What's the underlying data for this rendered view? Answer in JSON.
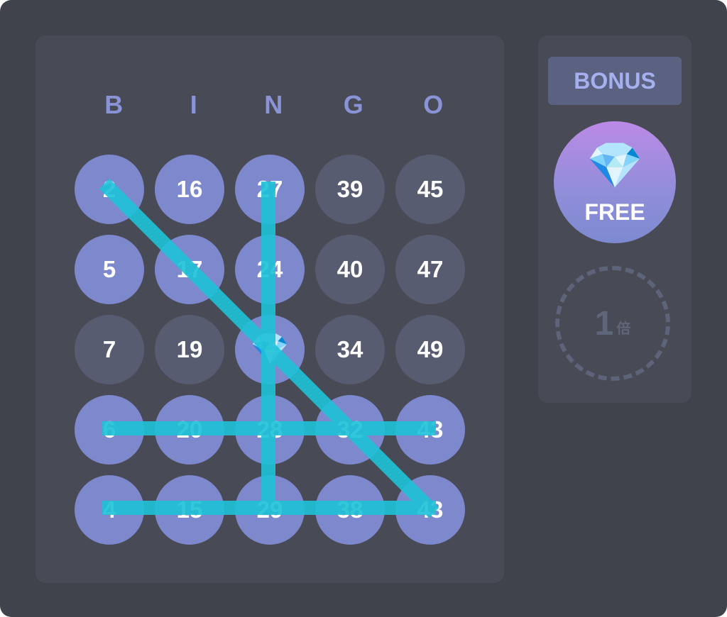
{
  "header": [
    "B",
    "I",
    "N",
    "G",
    "O"
  ],
  "grid": [
    [
      {
        "label": "2",
        "marked": true
      },
      {
        "label": "16",
        "marked": true
      },
      {
        "label": "27",
        "marked": true
      },
      {
        "label": "39",
        "marked": false
      },
      {
        "label": "45",
        "marked": false
      }
    ],
    [
      {
        "label": "5",
        "marked": true
      },
      {
        "label": "17",
        "marked": true
      },
      {
        "label": "24",
        "marked": true
      },
      {
        "label": "40",
        "marked": false
      },
      {
        "label": "47",
        "marked": false
      }
    ],
    [
      {
        "label": "7",
        "marked": false
      },
      {
        "label": "19",
        "marked": false
      },
      {
        "label": "💎",
        "marked": true,
        "free": true
      },
      {
        "label": "34",
        "marked": false
      },
      {
        "label": "49",
        "marked": false
      }
    ],
    [
      {
        "label": "6",
        "marked": true
      },
      {
        "label": "20",
        "marked": true
      },
      {
        "label": "28",
        "marked": true
      },
      {
        "label": "32",
        "marked": true
      },
      {
        "label": "43",
        "marked": true
      }
    ],
    [
      {
        "label": "4",
        "marked": true
      },
      {
        "label": "15",
        "marked": true
      },
      {
        "label": "29",
        "marked": true
      },
      {
        "label": "38",
        "marked": true
      },
      {
        "label": "43",
        "marked": true
      }
    ]
  ],
  "win_lines": [
    {
      "type": "diagonal",
      "from": "2",
      "to": "43"
    },
    {
      "type": "column",
      "column": "N"
    },
    {
      "type": "row",
      "row": 4
    },
    {
      "type": "row",
      "row": 5
    }
  ],
  "side": {
    "bonus_label": "BONUS",
    "free_icon": "💎",
    "free_label": "FREE",
    "multiplier_value": "1",
    "multiplier_unit": "倍"
  },
  "colors": {
    "marked": "#7d88cd",
    "unmarked": "#575c71",
    "line": "#1ec2d8",
    "header": "#8a93d6"
  }
}
